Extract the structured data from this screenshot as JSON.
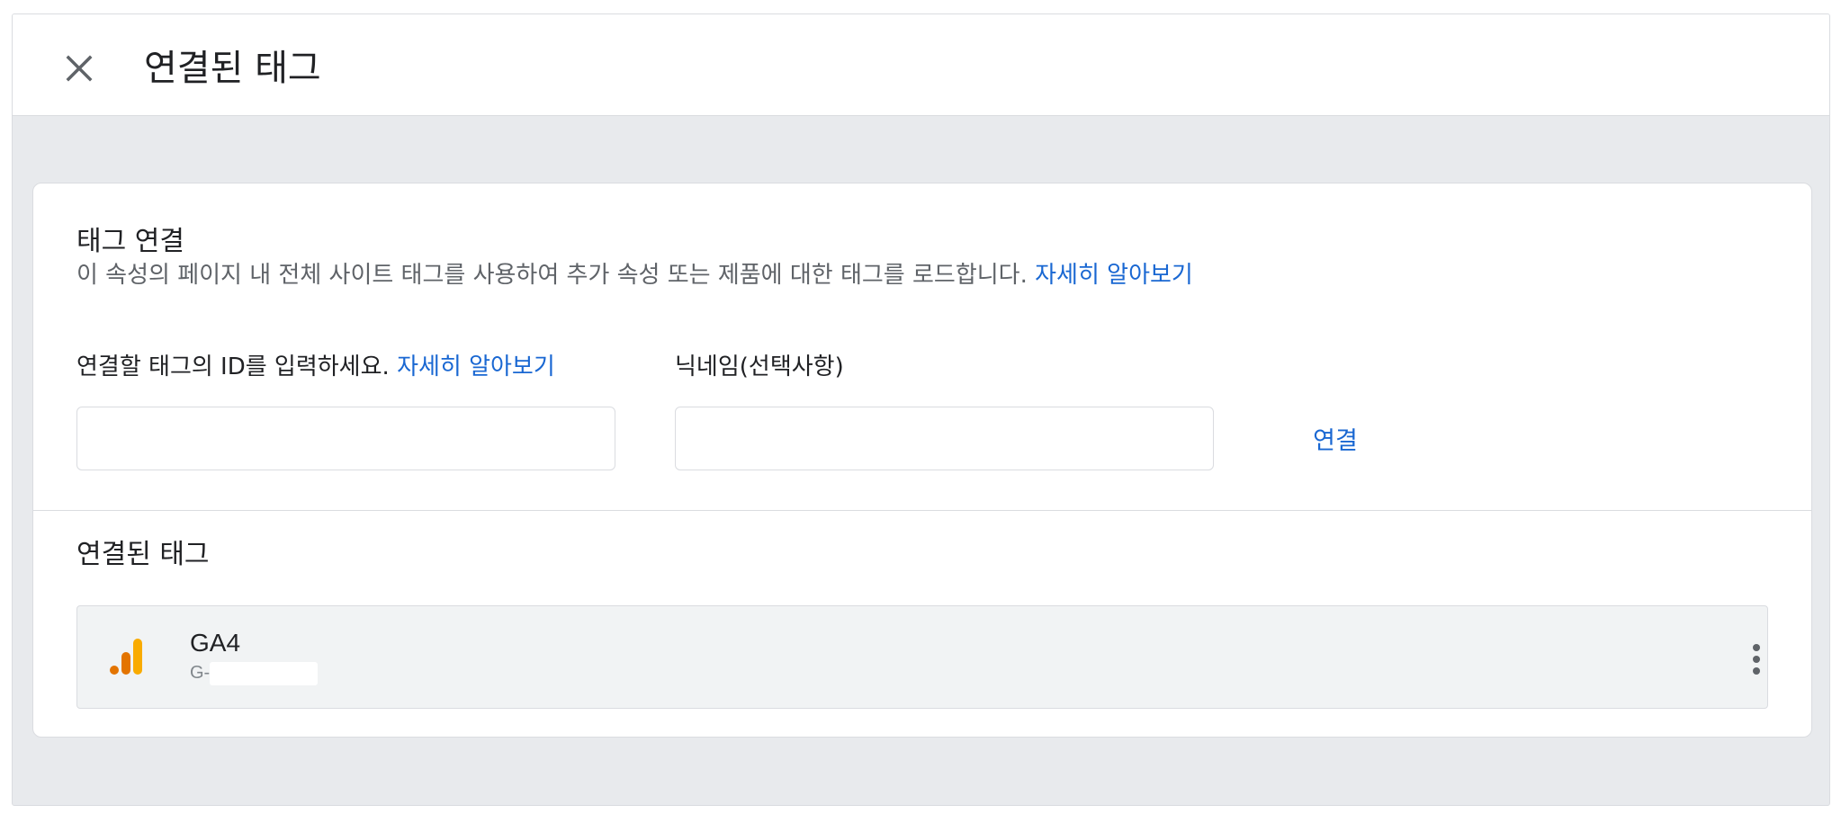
{
  "header": {
    "close_icon": "close-icon",
    "title": "연결된 태그"
  },
  "connect_section": {
    "title": "태그 연결",
    "description": "이 속성의 페이지 내 전체 사이트 태그를 사용하여 추가 속성 또는 제품에 대한 태그를 로드합니다.",
    "learn_more": "자세히 알아보기",
    "tag_id_label": "연결할 태그의 ID를 입력하세요.",
    "tag_id_learn_more": "자세히 알아보기",
    "tag_id_value": "",
    "nickname_label": "닉네임(선택사항)",
    "nickname_value": "",
    "connect_button": "연결"
  },
  "connected_section": {
    "title": "연결된 태그",
    "tags": [
      {
        "icon": "analytics-icon",
        "name": "GA4",
        "id": "G-",
        "menu_icon": "more-vert-icon"
      }
    ]
  },
  "colors": {
    "accent_link": "#1967d2",
    "analytics_orange": "#e37400",
    "analytics_yellow": "#f9ab00"
  }
}
